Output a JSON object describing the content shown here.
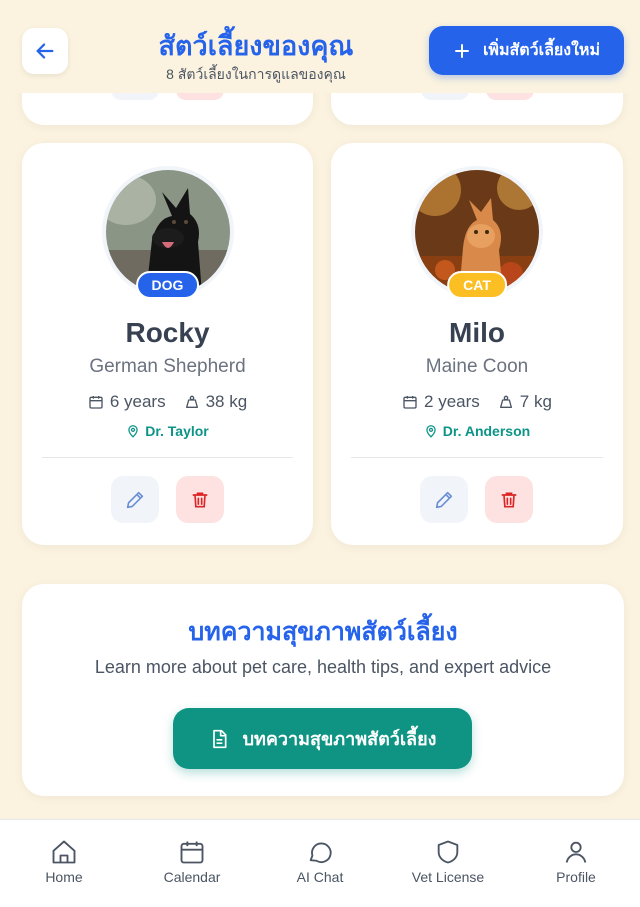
{
  "header": {
    "title": "สัตว์เลี้ยงของคุณ",
    "subtitle": "8 สัตว์เลี้ยงในการดูแลของคุณ",
    "add_button_label": "เพิ่มสัตว์เลี้ยงใหม่"
  },
  "pets": [
    {
      "name": "Rocky",
      "breed": "German Shepherd",
      "type_badge": "DOG",
      "age": "6 years",
      "weight": "38 kg",
      "vet": "Dr. Taylor"
    },
    {
      "name": "Milo",
      "breed": "Maine Coon",
      "type_badge": "CAT",
      "age": "2 years",
      "weight": "7 kg",
      "vet": "Dr. Anderson"
    }
  ],
  "article": {
    "title": "บทความสุขภาพสัตว์เลี้ยง",
    "description": "Learn more about pet care, health tips, and expert advice",
    "button_label": "บทความสุขภาพสัตว์เลี้ยง"
  },
  "nav": {
    "items": [
      {
        "label": "Home",
        "icon": "home-icon"
      },
      {
        "label": "Calendar",
        "icon": "calendar-icon"
      },
      {
        "label": "AI Chat",
        "icon": "chat-icon"
      },
      {
        "label": "Vet License",
        "icon": "shield-icon"
      },
      {
        "label": "Profile",
        "icon": "user-icon"
      }
    ]
  },
  "colors": {
    "background": "#fbf3df",
    "primary": "#2563eb",
    "teal": "#0f9484",
    "cat_badge": "#fbbf24",
    "delete_bg": "#fee2e2"
  }
}
